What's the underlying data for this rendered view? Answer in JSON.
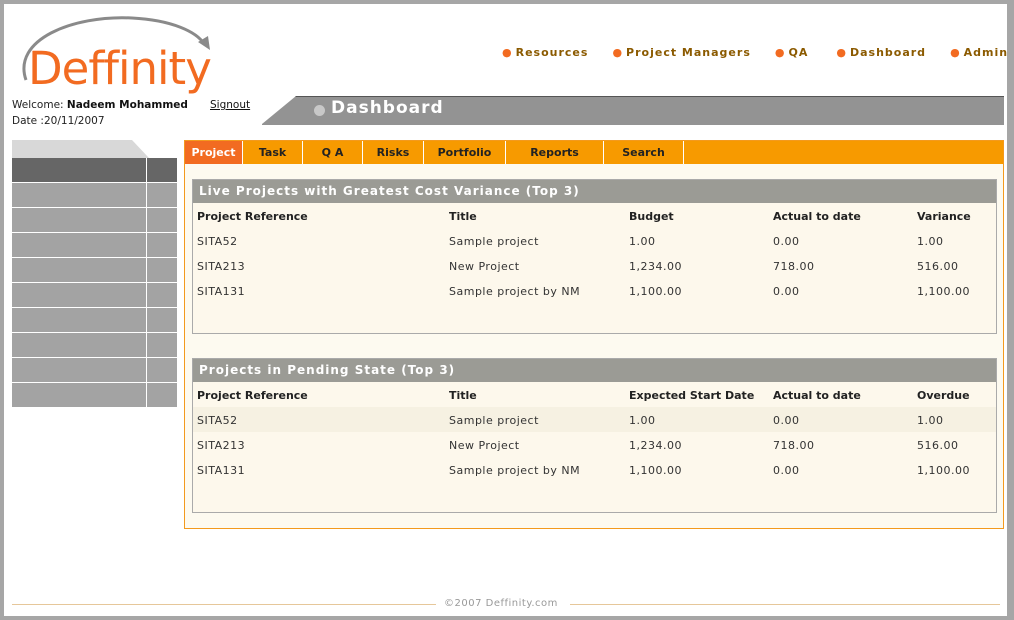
{
  "brand": {
    "logo_text": "Deffinity",
    "logo_color": "#f26b21"
  },
  "top_nav": [
    {
      "label": "Resources"
    },
    {
      "label": "Project Managers"
    },
    {
      "label": "QA"
    },
    {
      "label": "Dashboard"
    },
    {
      "label": "Admin"
    }
  ],
  "user": {
    "welcome_label": "Welcome:",
    "name": "Nadeem Mohammed",
    "signout": "Signout",
    "date_label": "Date :",
    "date": "20/11/2007"
  },
  "page_title": "Dashboard",
  "tabs": [
    "Project",
    "Task",
    "Q A",
    "Risks",
    "Portfolio",
    "Reports",
    "Search"
  ],
  "active_tab": "Project",
  "panels": {
    "cost_variance": {
      "title": "Live Projects with Greatest Cost Variance (Top 3)",
      "columns": [
        "Project Reference",
        "Title",
        "Budget",
        "Actual to date",
        "Variance"
      ],
      "rows": [
        [
          "SITA52",
          "Sample project",
          "1.00",
          "0.00",
          "1.00"
        ],
        [
          "SITA213",
          "New Project",
          "1,234.00",
          "718.00",
          "516.00"
        ],
        [
          "SITA131",
          "Sample project by NM",
          "1,100.00",
          "0.00",
          "1,100.00"
        ]
      ]
    },
    "pending": {
      "title": "Projects in Pending State (Top 3)",
      "columns": [
        "Project Reference",
        "Title",
        "Expected Start Date",
        "Actual to date",
        "Overdue"
      ],
      "rows": [
        [
          "SITA52",
          "Sample project",
          "1.00",
          "0.00",
          "1.00"
        ],
        [
          "SITA213",
          "New Project",
          "1,234.00",
          "718.00",
          "516.00"
        ],
        [
          "SITA131",
          "Sample project by NM",
          "1,100.00",
          "0.00",
          "1,100.00"
        ]
      ]
    }
  },
  "footer": "©2007 Deffinity.com",
  "colors": {
    "accent_orange": "#f79a00",
    "active_tab": "#f26b21",
    "header_gray": "#939393"
  }
}
